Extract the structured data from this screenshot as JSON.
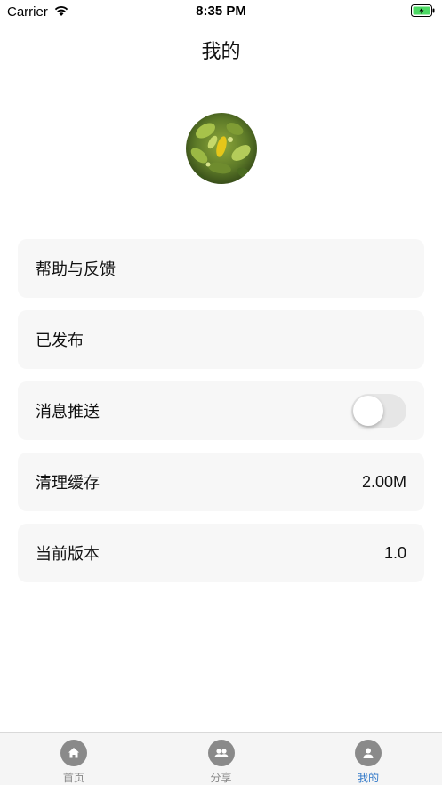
{
  "status_bar": {
    "carrier": "Carrier",
    "time": "8:35 PM"
  },
  "nav": {
    "title": "我的"
  },
  "menu": {
    "items": [
      {
        "label": "帮助与反馈",
        "value": ""
      },
      {
        "label": "已发布",
        "value": ""
      },
      {
        "label": "消息推送",
        "value": "",
        "toggle_on": false
      },
      {
        "label": "清理缓存",
        "value": "2.00M"
      },
      {
        "label": "当前版本",
        "value": "1.0"
      }
    ]
  },
  "tab_bar": {
    "tabs": [
      {
        "label": "首页",
        "icon": "home-icon",
        "active": false
      },
      {
        "label": "分享",
        "icon": "share-group-icon",
        "active": false
      },
      {
        "label": "我的",
        "icon": "user-icon",
        "active": true
      }
    ]
  },
  "colors": {
    "accent": "#2f77c8",
    "battery": "#4cd964",
    "row_bg": "#f7f7f7"
  }
}
